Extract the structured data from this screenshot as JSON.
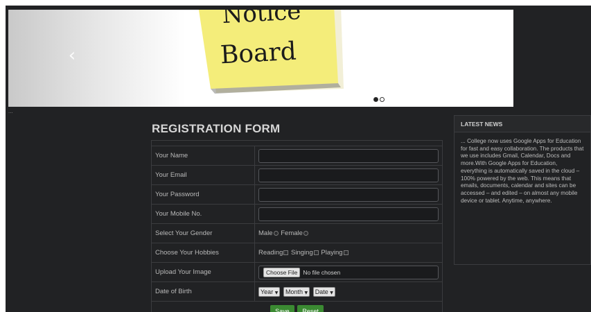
{
  "slider": {
    "image_text_line1": "Notice",
    "image_text_line2": "Board",
    "prev_arrow": "‹",
    "caption": "..."
  },
  "form": {
    "title": "REGISTRATION FORM",
    "name_label": "Your Name",
    "email_label": "Your Email",
    "password_label": "Your Password",
    "mobile_label": "Your Mobile No.",
    "gender_label": "Select Your Gender",
    "gender_options": [
      "Male",
      "Female"
    ],
    "hobbies_label": "Choose Your Hobbies",
    "hobby_options": [
      "Reading",
      "Singing",
      "Playing"
    ],
    "image_label": "Upload Your Image",
    "file_button": "Choose File",
    "file_status": "No file chosen",
    "dob_label": "Date of Birth",
    "dob_year": "Year",
    "dob_month": "Month",
    "dob_date": "Date",
    "save_label": "Save",
    "reset_label": "Reset"
  },
  "news": {
    "title": "LATEST NEWS",
    "body": "... College now uses Google Apps for Education for fast and easy collaboration. The products that we use includes Gmail, Calendar, Docs and more.With Google Apps for Education, everything is automatically saved in the cloud – 100% powered by the web. This means that emails, documents, calendar and sites can be accessed – and edited – on almost any mobile device or tablet. Anytime, anywhere."
  },
  "colors": {
    "background": "#212224",
    "note": "#f4ed7a",
    "button": "#3b8a32"
  }
}
